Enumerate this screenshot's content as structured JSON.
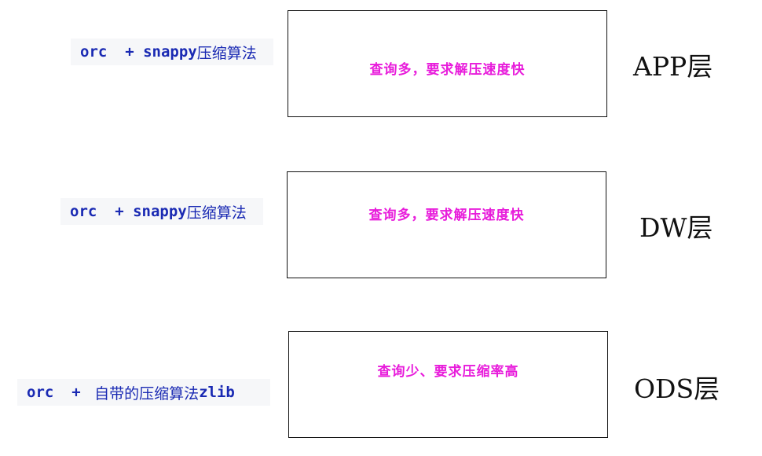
{
  "layers": [
    {
      "name": "APP层",
      "description": "查询多，要求解压速度快",
      "storage": {
        "format": "orc",
        "sep": "  + ",
        "codec": "snappy",
        "suffix": "压缩算法"
      }
    },
    {
      "name": "DW层",
      "description": "查询多，要求解压速度快",
      "storage": {
        "format": "orc",
        "sep": "  + ",
        "codec": "snappy",
        "suffix": "压缩算法"
      }
    },
    {
      "name": "ODS层",
      "description": "查询少、要求压缩率高",
      "storage": {
        "format": "orc",
        "sep": "  + ",
        "prefix": "自带的压缩算法",
        "codec": "zlib"
      }
    }
  ]
}
